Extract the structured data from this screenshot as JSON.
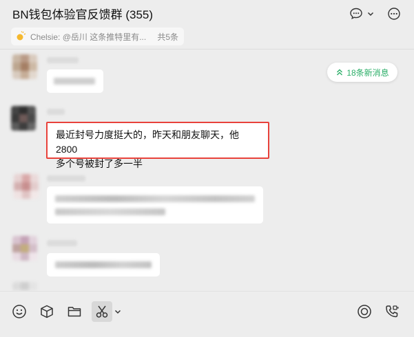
{
  "header": {
    "title": "BN钱包体验官反馈群 (355)"
  },
  "pinned": {
    "text": "Chelsie: @岳川 这条推特里有...",
    "count": "共5条"
  },
  "new_messages": {
    "label": "18条新消息",
    "color": "#2aae67"
  },
  "highlighted_message": {
    "line1": "最近封号力度挺大的，昨天和朋友聊天，他2800",
    "line2": "多个号被封了多一半",
    "border_color": "#e8413a"
  },
  "toolbar": {
    "icons": [
      "emoji-icon",
      "box-icon",
      "folder-icon",
      "scissors-icon",
      "chevron-down-icon",
      "live-icon",
      "video-call-icon"
    ]
  }
}
